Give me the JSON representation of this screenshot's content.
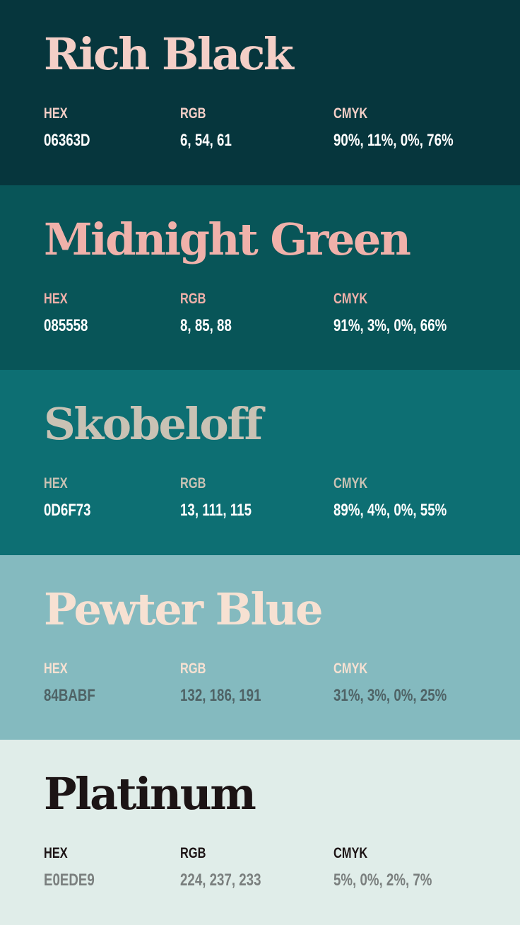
{
  "labels": {
    "hex": "HEX",
    "rgb": "RGB",
    "cmyk": "CMYK"
  },
  "swatches": [
    {
      "name": "Rich Black",
      "hex": "06363D",
      "rgb": "6, 54, 61",
      "cmyk": "90%, 11%, 0%, 76%",
      "colors": {
        "background": "#06363d",
        "name": "#f4cfc7",
        "label": "#f4cfc7",
        "value": "#ffffff"
      }
    },
    {
      "name": "Midnight Green",
      "hex": "085558",
      "rgb": "8, 85, 88",
      "cmyk": "91%, 3%, 0%, 66%",
      "colors": {
        "background": "#085558",
        "name": "#f0b1aa",
        "label": "#f0b1aa",
        "value": "#ffffff"
      }
    },
    {
      "name": "Skobeloff",
      "hex": "0D6F73",
      "rgb": "13, 111, 115",
      "cmyk": "89%, 4%, 0%, 55%",
      "colors": {
        "background": "#0d6f73",
        "name": "#c9c2b4",
        "label": "#c9c2b4",
        "value": "#ffffff"
      }
    },
    {
      "name": "Pewter Blue",
      "hex": "84BABF",
      "rgb": "132, 186, 191",
      "cmyk": "31%, 3%, 0%, 25%",
      "colors": {
        "background": "#84babf",
        "name": "#f7e1d2",
        "label": "#f7e1d2",
        "value": "#4f6366"
      }
    },
    {
      "name": "Platinum",
      "hex": "E0EDE9",
      "rgb": "224, 237, 233",
      "cmyk": "5%, 0%, 2%, 7%",
      "colors": {
        "background": "#e0ede9",
        "name": "#1c1415",
        "label": "#1c1415",
        "value": "#7a7f7e"
      }
    }
  ]
}
